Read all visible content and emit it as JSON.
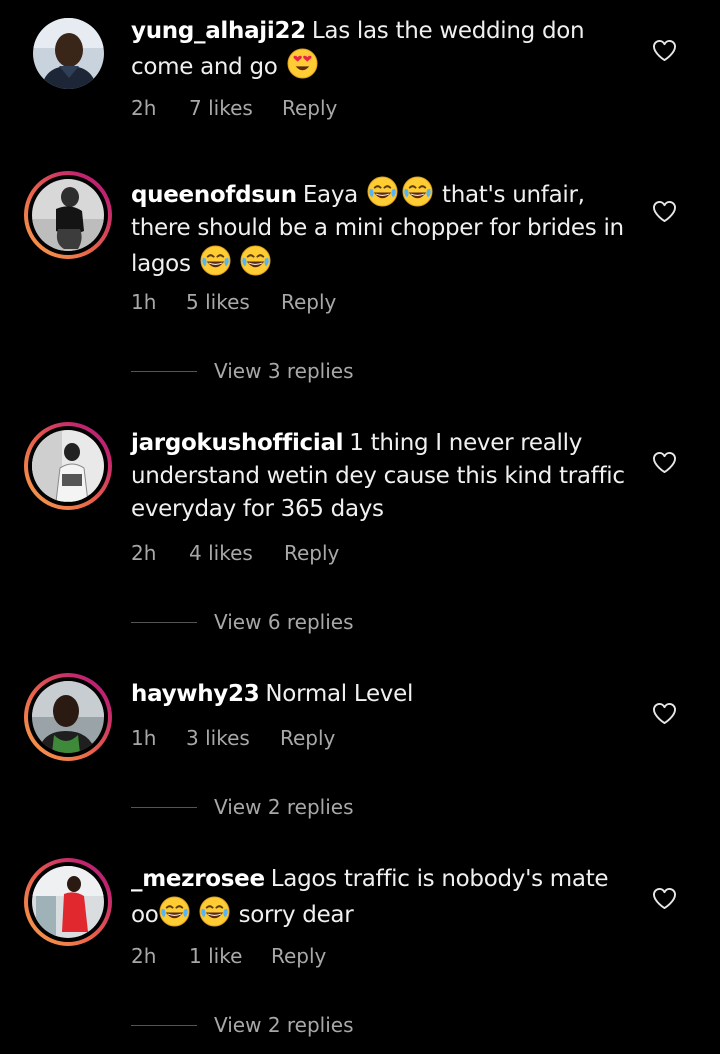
{
  "comments": [
    {
      "username": "yung_alhaji22",
      "text_1": "Las las the wedding don come and go",
      "emoji_after_1": "heart-eyes",
      "time": "2h",
      "likes": "7 likes",
      "reply": "Reply"
    },
    {
      "username": "queenofdsun",
      "text_1": "Eaya",
      "text_2": "that's unfair, there should be a mini chopper for brides in lagos",
      "time": "1h",
      "likes": "5 likes",
      "reply": "Reply",
      "view_replies": "View 3 replies"
    },
    {
      "username": "jargokushofficial",
      "text_1": "1 thing I never really understand wetin dey cause this kind traffic everyday for 365 days",
      "time": "2h",
      "likes": "4 likes",
      "reply": "Reply",
      "view_replies": "View 6 replies"
    },
    {
      "username": "haywhy23",
      "text_1": "Normal Level",
      "time": "1h",
      "likes": "3 likes",
      "reply": "Reply",
      "view_replies": "View 2 replies"
    },
    {
      "username": "_mezrosee",
      "text_1": "Lagos traffic is nobody's mate oo",
      "text_2": "sorry dear",
      "time": "2h",
      "likes": "1 like",
      "reply": "Reply",
      "view_replies": "View 2 replies"
    }
  ],
  "icons": {
    "like": "heart-outline-icon",
    "laugh": "face-with-tears-of-joy-emoji",
    "love": "smiling-face-with-heart-eyes-emoji"
  },
  "colors": {
    "background": "#000000",
    "text": "#f5f5f5",
    "meta": "#a8a8a8",
    "story_ring_start": "#f9a64a",
    "story_ring_end": "#a21f82"
  }
}
